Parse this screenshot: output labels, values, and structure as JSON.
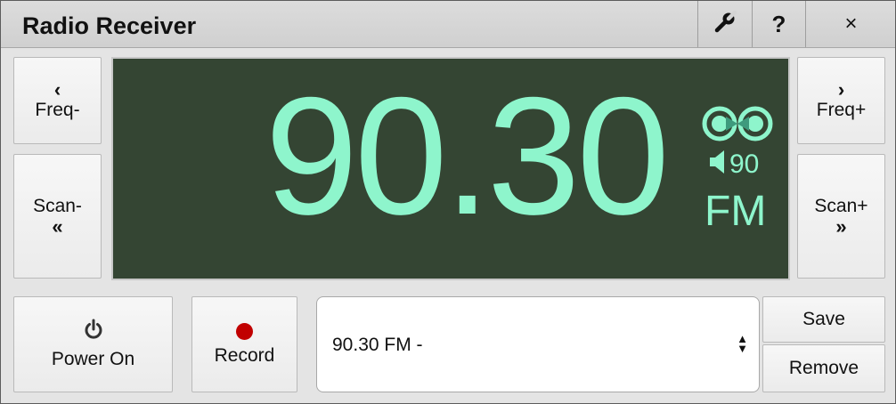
{
  "window": {
    "title": "Radio Receiver"
  },
  "titlebar": {
    "help_label": "?",
    "close_label": "×"
  },
  "nav": {
    "freq_down": "Freq-",
    "freq_up": "Freq+",
    "scan_down": "Scan-",
    "scan_up": "Scan+",
    "chev_left": "‹",
    "chev_right": "›",
    "dchev_left": "«",
    "dchev_right": "»"
  },
  "display": {
    "frequency": "90.30",
    "volume": "90",
    "band": "FM",
    "stereo_icon": "stereo-icon",
    "colors": {
      "background": "#344533",
      "text": "#8ef5cc"
    }
  },
  "controls": {
    "power_label": "Power On",
    "record_label": "Record",
    "save_label": "Save",
    "remove_label": "Remove"
  },
  "preset": {
    "selected": "90.30 FM -"
  }
}
